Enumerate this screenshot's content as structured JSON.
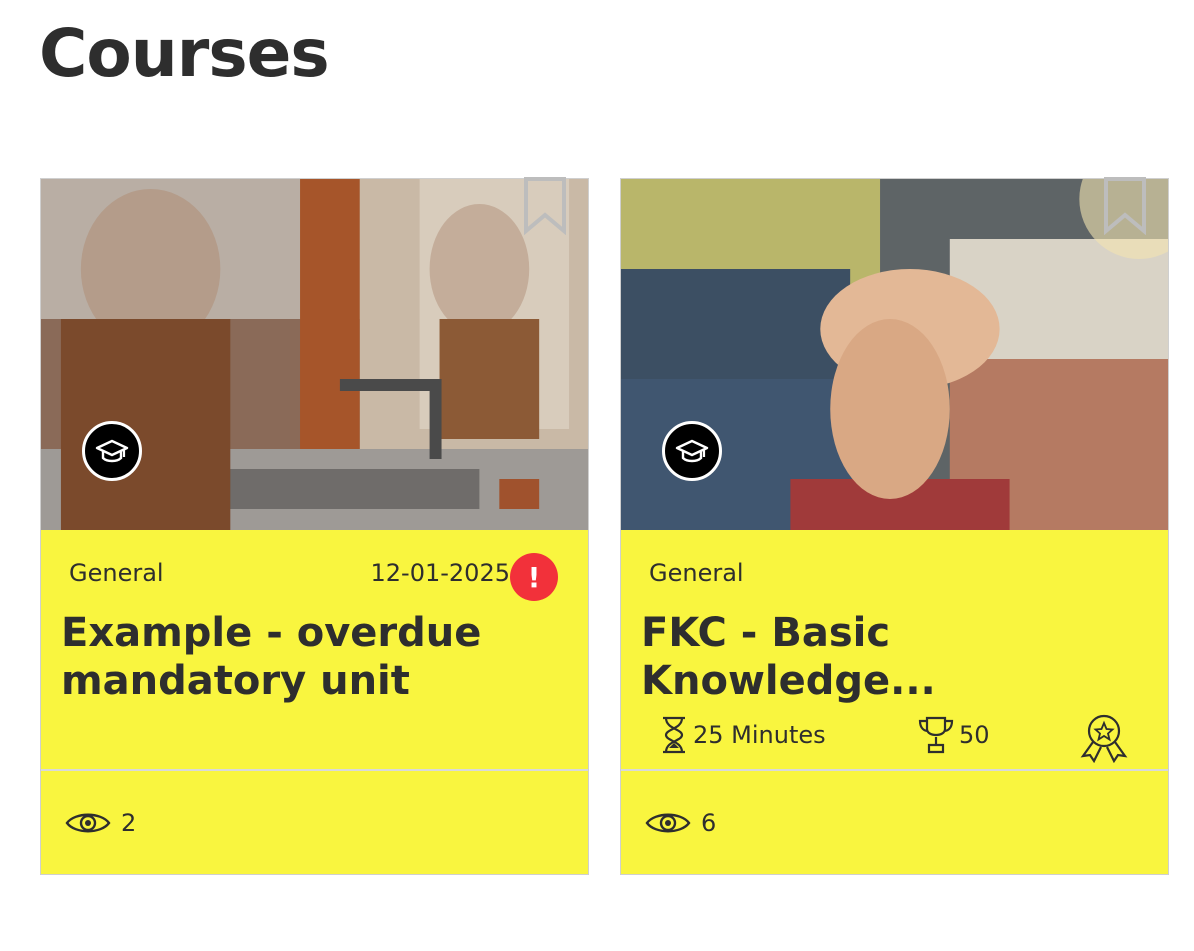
{
  "page": {
    "title": "Courses"
  },
  "courses": [
    {
      "category": "General",
      "due_date": "12-01-2025",
      "alert_symbol": "!",
      "title": "Example - overdue mandatory unit",
      "views": "2",
      "image": "woman washing hands at sink",
      "icon": "graduation-cap-icon"
    },
    {
      "category": "General",
      "title": "FKC - Basic Knowledge...",
      "duration": "25 Minutes",
      "points": "50",
      "views": "6",
      "image": "team hands stacked together",
      "icon": "graduation-cap-icon"
    }
  ],
  "colors": {
    "card_bg": "#f9f53f",
    "alert": "#f2313a",
    "text": "#2e2e2e"
  }
}
